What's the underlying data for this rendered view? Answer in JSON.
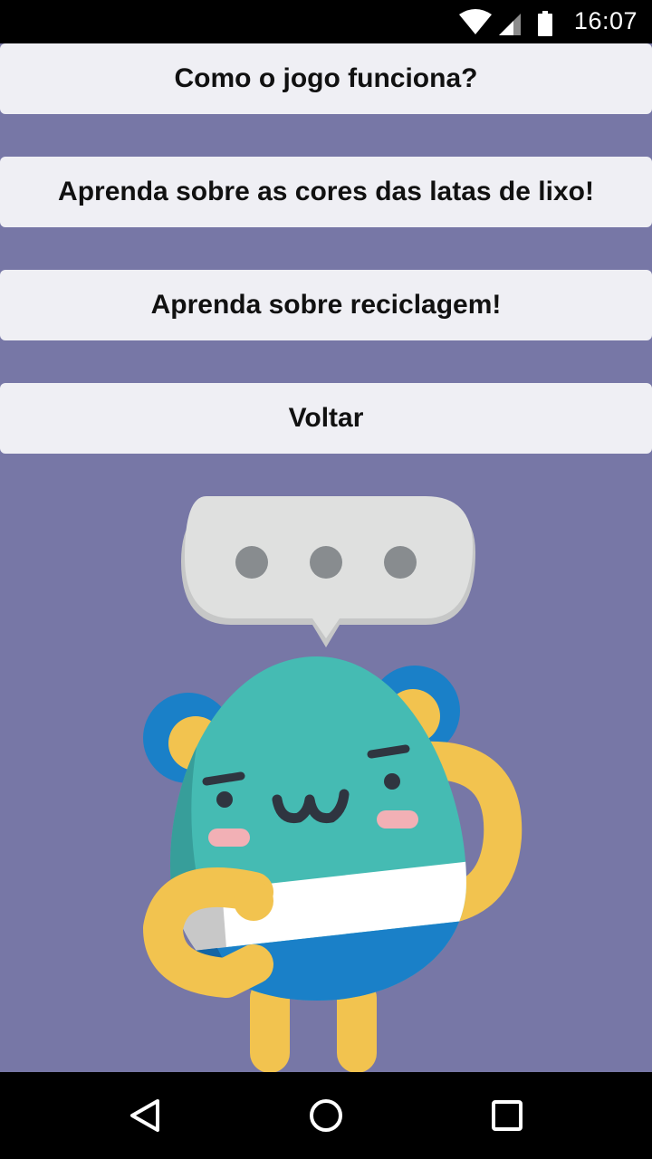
{
  "status_bar": {
    "time": "16:07",
    "icons": [
      "wifi-icon",
      "signal-icon",
      "battery-icon"
    ]
  },
  "menu": {
    "how_it_works": "Como o jogo funciona?",
    "trash_colors": "Aprenda sobre as cores das latas de lixo!",
    "recycling": "Aprenda sobre reciclagem!",
    "back": "Voltar"
  },
  "navigation": {
    "icons": [
      "back-triangle-icon",
      "home-circle-icon",
      "recents-square-icon"
    ]
  },
  "colors": {
    "background": "#7777a6",
    "button_bg": "#efeff4",
    "mascot_body": "#45bbb3",
    "mascot_limbs": "#f2c34f",
    "mascot_ears": "#1a80c8"
  }
}
